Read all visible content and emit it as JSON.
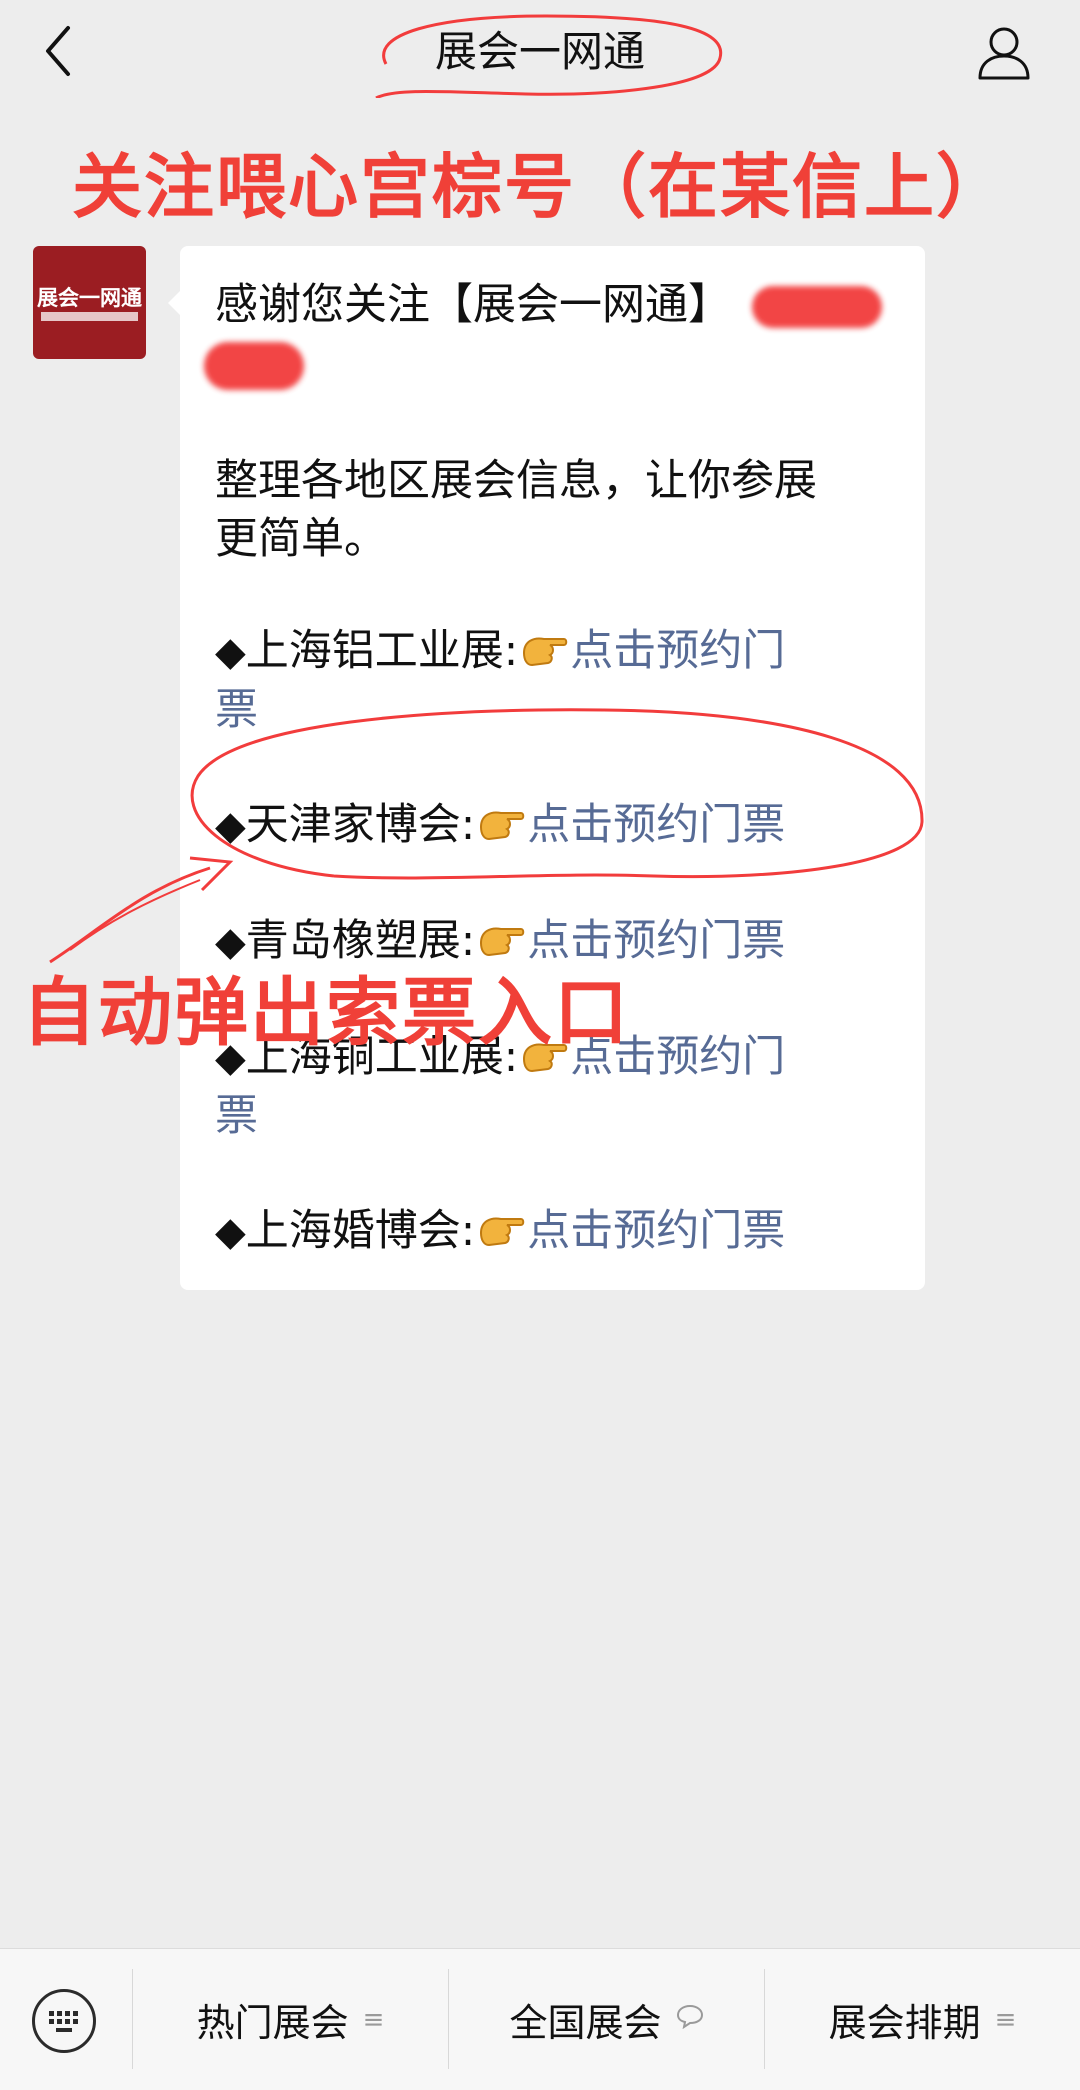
{
  "header": {
    "title": "展会一网通",
    "back_icon": "chevron-left-icon",
    "user_icon": "user-icon"
  },
  "annotations": {
    "top_note": "关注喂心宫棕号（在某信上）",
    "mid_note": "自动弹出索票入口",
    "color": "#f04038"
  },
  "avatar": {
    "name": "展会一网通"
  },
  "message": {
    "greeting": "感谢您关注【展会一网通】",
    "intro": "整理各地区展会信息，让你参展更简单。",
    "intro_line1": "整理各地区展会信息，让你参展",
    "intro_line2": "更简单。",
    "link_text": "点击预约门票",
    "link_color": "#576b95",
    "items": [
      {
        "bullet": "◆",
        "name": "上海铝工业展:",
        "link_a": "点击预约门",
        "link_b": "票"
      },
      {
        "bullet": "◆",
        "name": "天津家博会:",
        "link_a": "点击预约门票",
        "link_b": ""
      },
      {
        "bullet": "◆",
        "name": "青岛橡塑展:",
        "link_a": "点击预约门票",
        "link_b": ""
      },
      {
        "bullet": "◆",
        "name": "上海铜工业展:",
        "link_a": "点击预约门",
        "link_b": "票"
      },
      {
        "bullet": "◆",
        "name": "上海婚博会:",
        "link_a": "点击预约门票",
        "link_b": ""
      }
    ]
  },
  "bottom_menu": {
    "keyboard_icon": "keyboard-icon",
    "items": [
      {
        "label": "热门展会",
        "icon": "menu-lines-icon"
      },
      {
        "label": "全国展会",
        "icon": "chat-bubble-icon"
      },
      {
        "label": "展会排期",
        "icon": "menu-lines-icon"
      }
    ]
  }
}
